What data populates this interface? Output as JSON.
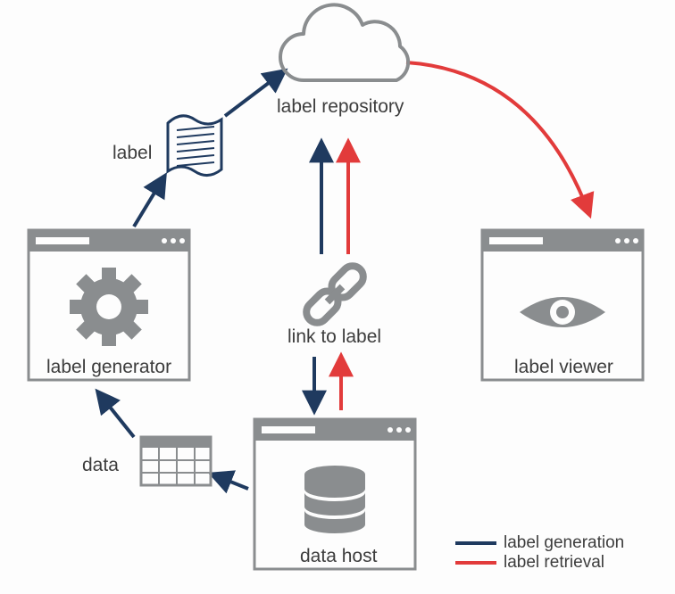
{
  "nodes": {
    "label_repository": "label repository",
    "label_generator": "label generator",
    "label_viewer": "label viewer",
    "data_host": "data host"
  },
  "edges": {
    "label": "label",
    "data": "data",
    "link_to_label": "link to label"
  },
  "legend": {
    "generation": "label generation",
    "retrieval": "label retrieval"
  },
  "colors": {
    "gray": "#8a8d8f",
    "blue": "#1f3a5f",
    "red": "#e23b3b",
    "text": "#3d3d3d"
  }
}
